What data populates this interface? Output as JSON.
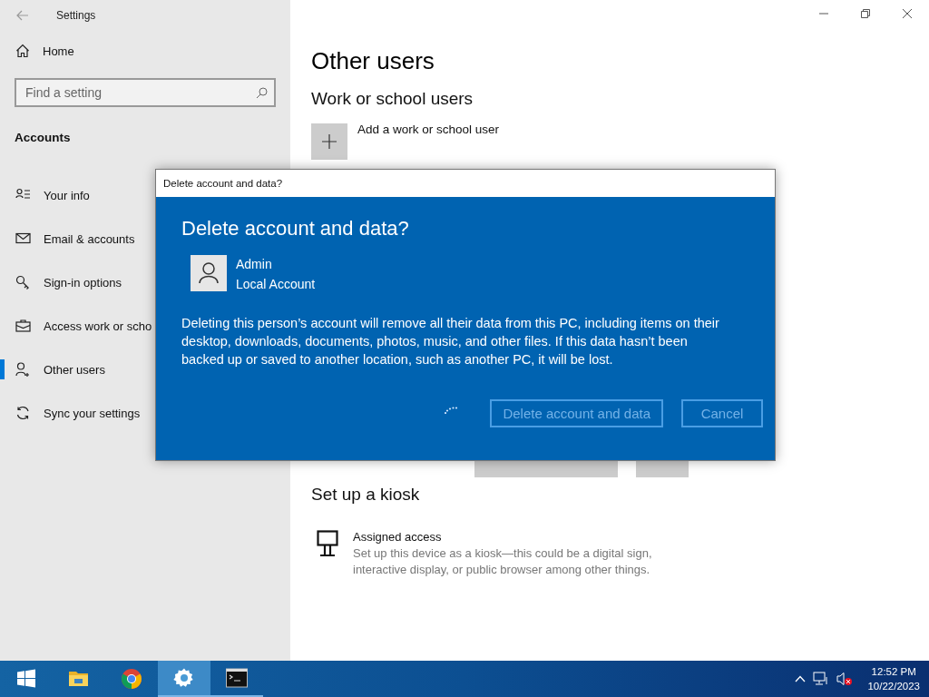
{
  "window": {
    "title": "Settings"
  },
  "sidebar": {
    "home": "Home",
    "search": {
      "placeholder": "Find a setting"
    },
    "section": "Accounts",
    "items": [
      {
        "label": "Your info",
        "selected": false
      },
      {
        "label": "Email & accounts",
        "selected": false
      },
      {
        "label": "Sign-in options",
        "selected": false
      },
      {
        "label": "Access work or scho",
        "selected": false
      },
      {
        "label": "Other users",
        "selected": true
      },
      {
        "label": "Sync your settings",
        "selected": false
      }
    ]
  },
  "main": {
    "title": "Other users",
    "work_heading": "Work or school users",
    "add_label": "Add a work or school user",
    "kiosk_heading": "Set up a kiosk",
    "kiosk_title": "Assigned access",
    "kiosk_desc": "Set up this device as a kiosk—this could be a digital sign, interactive display, or public browser among other things."
  },
  "dialog": {
    "title": "Delete account and data?",
    "heading": "Delete account and data?",
    "user_name": "Admin",
    "user_type": "Local Account",
    "message": "Deleting this person’s account will remove all their data from this PC, including items on their desktop, downloads, documents, photos, music, and other files. If this data hasn’t been backed up or saved to another location, such as another PC, it will be lost.",
    "busy": true,
    "buttons": [
      {
        "label": "Delete account and data",
        "disabled": true
      },
      {
        "label": "Cancel",
        "disabled": true
      }
    ]
  },
  "taskbar": {
    "apps": [
      {
        "kind": "start",
        "active": false,
        "running": false
      },
      {
        "kind": "explorer",
        "active": false,
        "running": false
      },
      {
        "kind": "chrome",
        "active": false,
        "running": false
      },
      {
        "kind": "settings",
        "active": true,
        "running": true
      },
      {
        "kind": "terminal",
        "active": false,
        "running": true
      }
    ],
    "time": "12:52 PM",
    "date": "10/22/2023"
  }
}
